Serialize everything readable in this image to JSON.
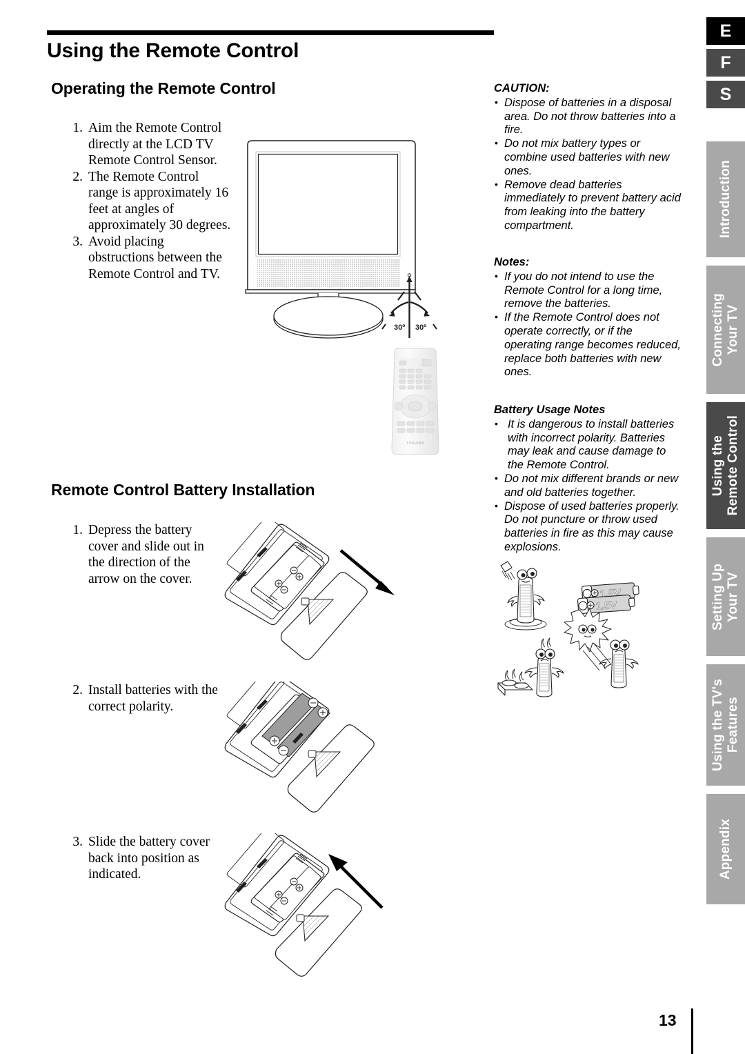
{
  "document": {
    "page_title": "Using the Remote Control",
    "page_number": "13"
  },
  "sections": {
    "operating": {
      "heading": "Operating the Remote Control",
      "steps": [
        {
          "num": "1.",
          "text": "Aim the Remote Control directly at the LCD TV Remote Control Sensor."
        },
        {
          "num": "2.",
          "text": "The Remote Control range is approximately 16 feet at angles of approximately 30 degrees."
        },
        {
          "num": "3.",
          "text": "Avoid placing obstructions between the Remote Control and TV."
        }
      ]
    },
    "battery_installation": {
      "heading": "Remote Control Battery Installation",
      "steps": [
        {
          "num": "1.",
          "text": "Depress the battery cover and slide out in the direction of the arrow on the cover."
        },
        {
          "num": "2.",
          "text": "Install batteries with the correct polarity."
        },
        {
          "num": "3.",
          "text": "Slide the battery cover back into position as indicated."
        }
      ]
    }
  },
  "caution": {
    "heading": "CAUTION:",
    "items": [
      "Dispose of batteries in a disposal area. Do not throw batteries into a fire.",
      "Do not mix battery types or combine used batteries with new ones.",
      "Remove dead batteries immediately to prevent battery acid from leaking into the battery compartment."
    ]
  },
  "notes": {
    "heading": "Notes:",
    "items": [
      "If you do not intend to use the Remote Control for a long time, remove the batteries.",
      "If the Remote Control does not operate correctly, or if the operating range becomes reduced, replace both batteries with new ones."
    ]
  },
  "battery_usage_notes": {
    "heading": "Battery Usage Notes",
    "items": [
      "It is dangerous to install batteries with incorrect polarity. Batteries may leak and cause damage to the Remote Control.",
      "Do not mix different brands or new and old batteries together.",
      "Dispose of used batteries properly. Do not puncture or throw used batteries in fire as this may cause explosions."
    ]
  },
  "sidebar": {
    "language_tabs": [
      {
        "label": "E",
        "state": "active"
      },
      {
        "label": "F",
        "state": "idle"
      },
      {
        "label": "S",
        "state": "idle"
      }
    ],
    "chapter_tabs": [
      {
        "label": "Introduction",
        "state": "idle"
      },
      {
        "label": "Connecting\nYour TV",
        "state": "idle"
      },
      {
        "label": "Using the\nRemote Control",
        "state": "active"
      },
      {
        "label": "Setting Up\nYour TV",
        "state": "idle"
      },
      {
        "label": "Using the TV's\nFeatures",
        "state": "idle"
      },
      {
        "label": "Appendix",
        "state": "idle"
      }
    ]
  },
  "figures": {
    "tv_diagram": {
      "name": "lcd-tv-front-with-viewing-angle",
      "angle_left": "30º",
      "angle_right": "30º"
    },
    "remote_diagram": {
      "name": "remote-control-front",
      "brand": "TOSHIBA"
    },
    "battery_figures": [
      "remote-back-cover-slide-out",
      "remote-batteries-inserted",
      "remote-back-cover-slide-in"
    ],
    "battery_characters": {
      "name": "battery-safety-cartoons",
      "battery_labels": [
        "1.5V",
        "1.5V"
      ]
    }
  },
  "colors": {
    "active_tab": "#000000",
    "idle_language_tab": "#4a4a4a",
    "chapter_tab": "#a8a8a8",
    "active_chapter_tab": "#4a4a4a",
    "text": "#000000"
  }
}
